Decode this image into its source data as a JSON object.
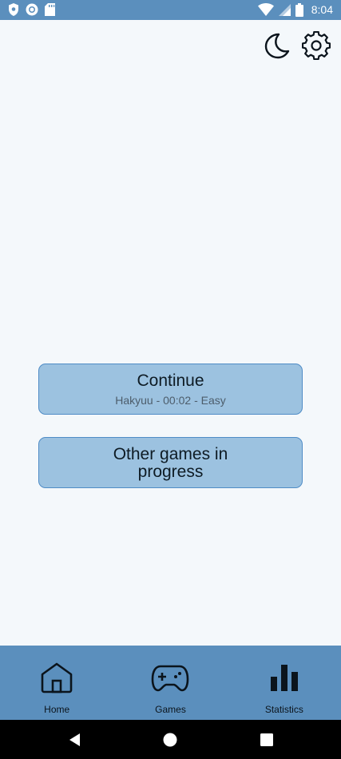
{
  "status_bar": {
    "time": "8:04",
    "left_icons": [
      "shield-icon",
      "circle-record-icon",
      "sd-card-icon"
    ],
    "right_icons": [
      "wifi-icon",
      "signal-icon",
      "battery-icon"
    ]
  },
  "top_actions": {
    "icons": [
      "moon-icon",
      "gear-icon"
    ]
  },
  "main": {
    "continue": {
      "title": "Continue",
      "subtitle": "Hakyuu - 00:02 - Easy"
    },
    "other_games": {
      "title": "Other games in progress"
    }
  },
  "bottom_nav": {
    "items": [
      {
        "label": "Home",
        "icon": "home-icon"
      },
      {
        "label": "Games",
        "icon": "gamepad-icon"
      },
      {
        "label": "Statistics",
        "icon": "bar-chart-icon"
      }
    ]
  },
  "system_nav": {
    "icons": [
      "back-icon",
      "home-circle-icon",
      "recents-icon"
    ]
  },
  "colors": {
    "status_bar": "#5b8fbd",
    "background": "#f4f8fb",
    "button_fill": "#9cc2e0",
    "button_border": "#4f8cc6",
    "nav_bar": "#5b8fbd"
  }
}
